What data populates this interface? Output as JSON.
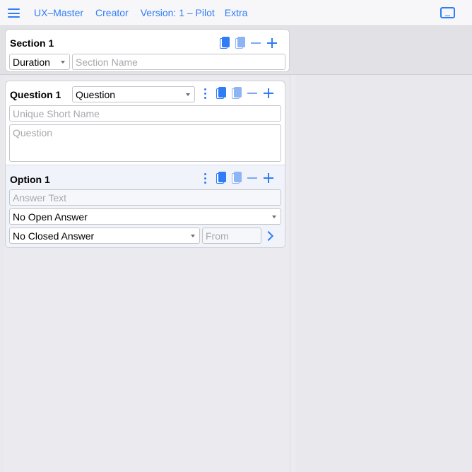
{
  "header": {
    "nav": [
      "UX–Master",
      "Creator",
      "Version: 1 – Pilot",
      "Extra"
    ]
  },
  "section": {
    "title": "Section 1",
    "type_select": "Duration",
    "name_placeholder": "Section Name"
  },
  "question": {
    "title": "Question 1",
    "type_select": "Question",
    "short_name_placeholder": "Unique Short Name",
    "question_placeholder": "Question"
  },
  "option": {
    "title": "Option 1",
    "answer_placeholder": "Answer Text",
    "open_answer_select": "No Open Answer",
    "closed_answer_select": "No Closed Answer",
    "from_placeholder": "From"
  },
  "colors": {
    "accent": "#2f7cf6",
    "background": "#e9e9ed",
    "card": "#ffffff",
    "option_bg": "#f0f3fa"
  },
  "icons": {
    "menu": "hamburger-icon",
    "screen": "screen-icon",
    "copy": "copy-icon",
    "paste": "paste-icon",
    "remove": "minus-icon",
    "add": "plus-icon",
    "more": "kebab-icon",
    "next": "chevron-right-icon"
  }
}
